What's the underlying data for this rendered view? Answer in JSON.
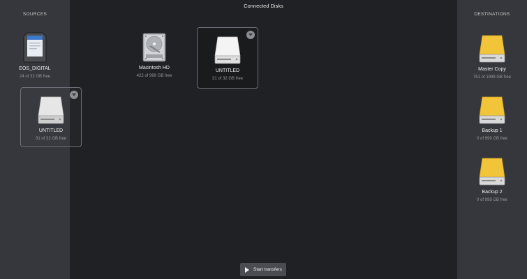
{
  "window": {
    "title": "Connected Disks"
  },
  "sources": {
    "title": "SOURCES",
    "items": [
      {
        "name": "EOS_DIGITAL",
        "free": "24 of 32 GB free",
        "icon": "sd-card-icon"
      },
      {
        "name": "UNTITLED",
        "free": "31 of 32 GB free",
        "icon": "white-drive-icon"
      }
    ]
  },
  "connected": {
    "items": [
      {
        "name": "Macintosh HD",
        "free": "422 of 999 GB free",
        "icon": "internal-hard-drive-icon"
      },
      {
        "name": "UNTITLED",
        "free": "31 of 32 GB free",
        "icon": "white-drive-icon"
      }
    ]
  },
  "destinations": {
    "title": "DESTINATIONS",
    "items": [
      {
        "name": "Master Copy",
        "free": "751 of 1999 GB free",
        "icon": "yellow-drive-icon"
      },
      {
        "name": "Backup 1",
        "free": "0 of 999 GB free",
        "icon": "yellow-drive-icon"
      },
      {
        "name": "Backup 2",
        "free": "0 of 999 GB free",
        "icon": "yellow-drive-icon"
      }
    ]
  },
  "footer": {
    "start_label": "Start transfers"
  },
  "colors": {
    "background": "#202124",
    "side_panel": "#35373c",
    "drive_yellow": "#f2c43a",
    "drive_white": "#eeeeee"
  }
}
